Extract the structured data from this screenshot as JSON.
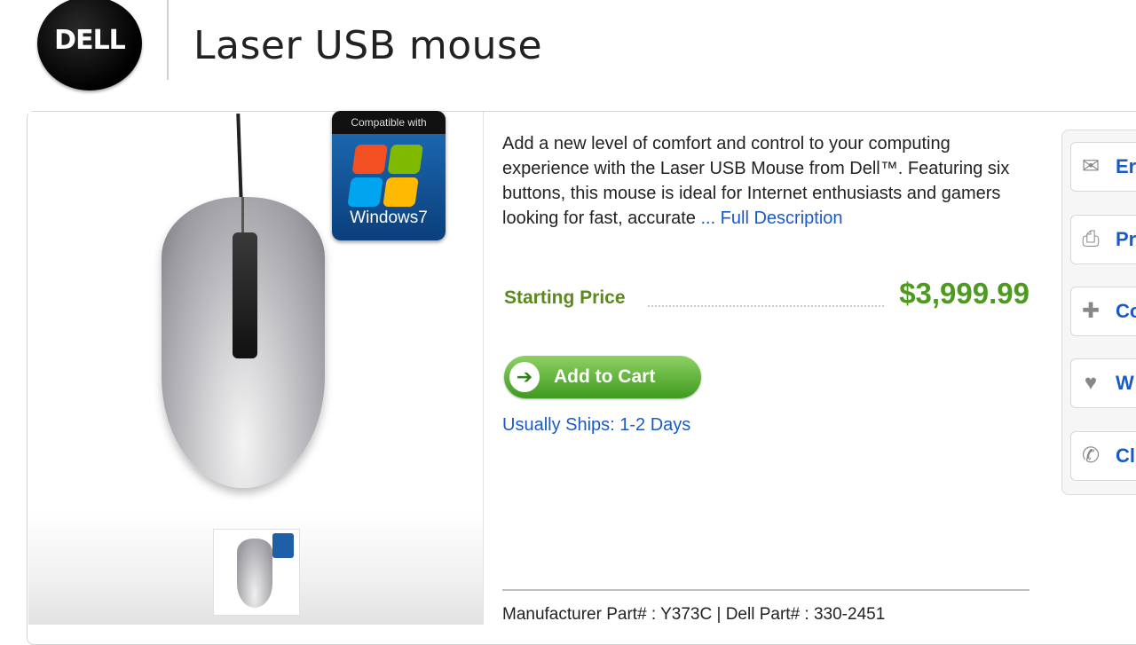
{
  "header": {
    "logo_text": "DELL",
    "title": "Laser USB mouse"
  },
  "product": {
    "badge_top": "Compatible with",
    "badge_bottom": "Windows7",
    "description": "Add a new level of comfort and control to your computing experience with the Laser USB Mouse from Dell™. Featuring six buttons, this mouse is ideal for Internet enthusiasts and gamers looking for fast, accurate",
    "full_description_link": "... Full Description",
    "price_label": "Starting Price",
    "price_value": "$3,999.99",
    "add_to_cart": "Add to Cart",
    "ships": "Usually Ships: 1-2 Days",
    "manufacturer_line": "Manufacturer Part# : Y373C | Dell Part# : 330-2451"
  },
  "sidebar": {
    "items": [
      {
        "icon": "email-icon",
        "glyph": "✉",
        "label": "Er"
      },
      {
        "icon": "print-icon",
        "glyph": "⎙",
        "label": "Pr"
      },
      {
        "icon": "compare-icon",
        "glyph": "✚",
        "label": "Co"
      },
      {
        "icon": "wishlist-icon",
        "glyph": "♥",
        "label": "W"
      },
      {
        "icon": "phone-icon",
        "glyph": "✆",
        "label": "Cli"
      }
    ]
  },
  "colors": {
    "price_green": "#4c9a1e",
    "link_blue": "#1a5ac8",
    "cart_green": "#3f9a1f"
  }
}
